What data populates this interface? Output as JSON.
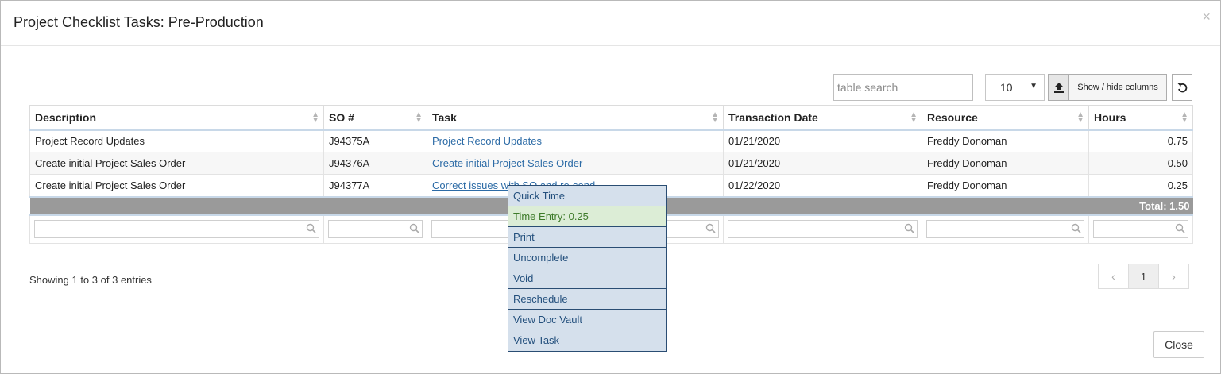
{
  "modal": {
    "title": "Project Checklist Tasks: Pre-Production",
    "close_x": "×",
    "close_button": "Close"
  },
  "toolbar": {
    "search_placeholder": "table search",
    "page_size": "10",
    "columns_button": "Show / hide columns"
  },
  "table": {
    "columns": [
      "Description",
      "SO #",
      "Task",
      "Transaction Date",
      "Resource",
      "Hours"
    ],
    "rows": [
      {
        "description": "Project Record Updates",
        "so": "J94375A",
        "task": "Project Record Updates",
        "date": "01/21/2020",
        "resource": "Freddy Donoman",
        "hours": "0.75"
      },
      {
        "description": "Create initial Project Sales Order",
        "so": "J94376A",
        "task": "Create initial Project Sales Order",
        "date": "01/21/2020",
        "resource": "Freddy Donoman",
        "hours": "0.50"
      },
      {
        "description": "Create initial Project Sales Order",
        "so": "J94377A",
        "task": "Correct issues with SO and re-send",
        "date": "01/22/2020",
        "resource": "Freddy Donoman",
        "hours": "0.25"
      }
    ],
    "total": "Total: 1.50"
  },
  "footer": {
    "info": "Showing 1 to 3 of 3 entries",
    "pager": {
      "prev": "‹",
      "current": "1",
      "next": "›"
    }
  },
  "context_menu": {
    "items": [
      "Quick Time",
      "Time Entry: 0.25",
      "Print",
      "Uncomplete",
      "Void",
      "Reschedule",
      "View Doc Vault",
      "View Task"
    ]
  },
  "colors": {
    "link": "#2c6ba6",
    "total_bar": "#9a9a9a",
    "menu_bg": "#d5e0ec",
    "menu_highlight": "#dcedd6"
  }
}
